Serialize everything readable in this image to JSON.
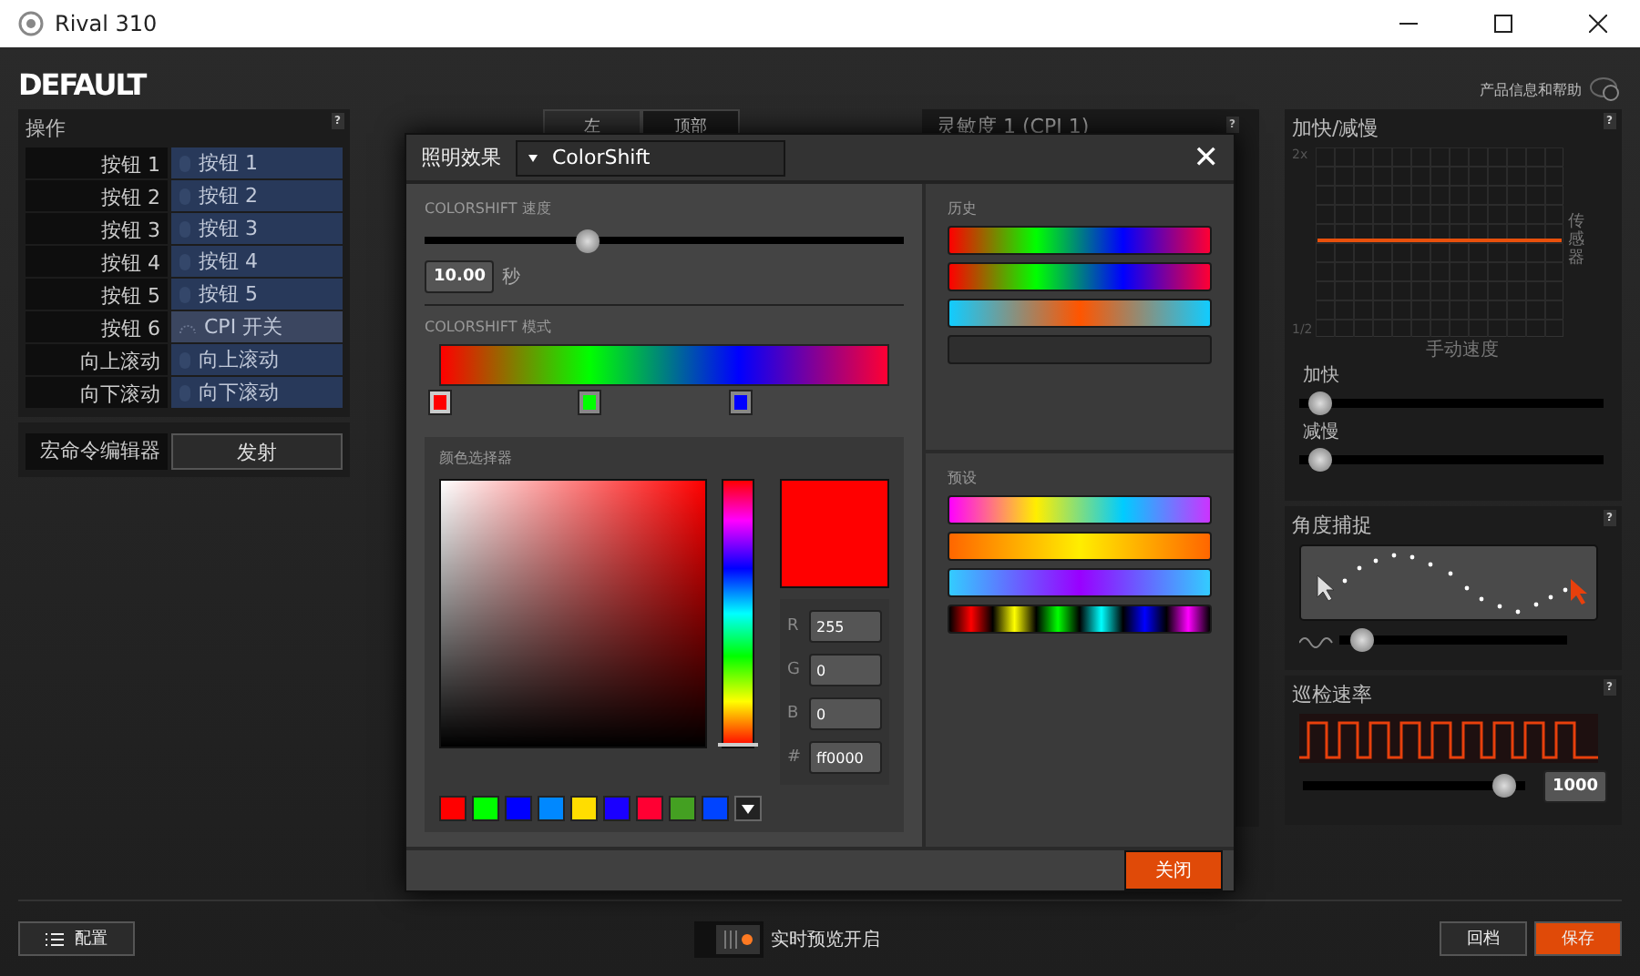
{
  "window": {
    "title": "Rival 310"
  },
  "profile": {
    "name": "DEFAULT",
    "help": "产品信息和帮助"
  },
  "actions": {
    "title": "操作",
    "help": "?",
    "rows": [
      {
        "button": "按钮 1",
        "binding": "按钮 1",
        "kind": "mouse"
      },
      {
        "button": "按钮 2",
        "binding": "按钮 2",
        "kind": "mouse"
      },
      {
        "button": "按钮 3",
        "binding": "按钮 3",
        "kind": "mouse"
      },
      {
        "button": "按钮 4",
        "binding": "按钮 4",
        "kind": "mouse"
      },
      {
        "button": "按钮 5",
        "binding": "按钮 5",
        "kind": "mouse"
      },
      {
        "button": "按钮 6",
        "binding": "CPI 开关",
        "kind": "cpi"
      },
      {
        "button": "向上滚动",
        "binding": "向上滚动",
        "kind": "mouse"
      },
      {
        "button": "向下滚动",
        "binding": "向下滚动",
        "kind": "mouse"
      }
    ],
    "macro_label": "宏命令编辑器",
    "macro_button": "发射"
  },
  "middle": {
    "tabs": [
      {
        "label": "左",
        "selected": true
      },
      {
        "label": "顶部",
        "selected": false
      }
    ],
    "sensitivity_title": "灵敏度 1 (CPI 1)",
    "help": "?"
  },
  "dialog": {
    "label": "照明效果",
    "effect": "ColorShift",
    "close": "✕",
    "speed": {
      "label": "COLORSHIFT 速度",
      "level": 0.33,
      "value": "10.00",
      "unit": "秒"
    },
    "pattern": {
      "label": "COLORSHIFT 模式",
      "stops": [
        {
          "color": "#ff0000",
          "selected": true
        },
        {
          "color": "#00ff00",
          "selected": false
        },
        {
          "color": "#0000ff",
          "selected": false
        }
      ]
    },
    "picker": {
      "title": "颜色选择器",
      "color": "#ff0000",
      "hue": {
        "level": 0
      },
      "fields": [
        {
          "label": "R",
          "value": "255"
        },
        {
          "label": "G",
          "value": "0"
        },
        {
          "label": "B",
          "value": "0"
        },
        {
          "label": "#",
          "value": "ff0000"
        }
      ],
      "swatches": [
        {
          "color": "#ff0000"
        },
        {
          "color": "#00ff00"
        },
        {
          "color": "#0000ff"
        },
        {
          "color": "#0088ff"
        },
        {
          "color": "#ffdd00"
        },
        {
          "color": "#1a00ff"
        },
        {
          "color": "#ff0033"
        },
        {
          "color": "#44a022"
        },
        {
          "color": "#0044ff"
        }
      ]
    },
    "history": {
      "title": "历史",
      "items": [
        {
          "kind": "rainbow"
        },
        {
          "kind": "rainbow"
        },
        {
          "kind": "cyan_orange"
        },
        {
          "kind": "empty"
        }
      ]
    },
    "presets": {
      "title": "预设",
      "items": [
        {
          "kind": "spectrum"
        },
        {
          "kind": "fire"
        },
        {
          "kind": "ice"
        },
        {
          "kind": "pulses"
        }
      ]
    },
    "close_button": "关闭"
  },
  "acceleration": {
    "title": "加快/减慢",
    "help": "?",
    "y_max": "2x",
    "y_min": "1/2",
    "y_label": "传感器",
    "x_label": "手动速度",
    "sliders": [
      {
        "label": "加快",
        "level": 0.03
      },
      {
        "label": "减慢",
        "level": 0.03
      }
    ]
  },
  "angle_snapping": {
    "title": "角度捕捉",
    "help": "?",
    "level": 0.05
  },
  "polling": {
    "title": "巡检速率",
    "help": "?",
    "level": 0.95,
    "value": "1000"
  },
  "footer": {
    "config": "配置",
    "live_preview": {
      "on": true,
      "label": "实时预览开启"
    },
    "revert": "回档",
    "save": "保存"
  }
}
